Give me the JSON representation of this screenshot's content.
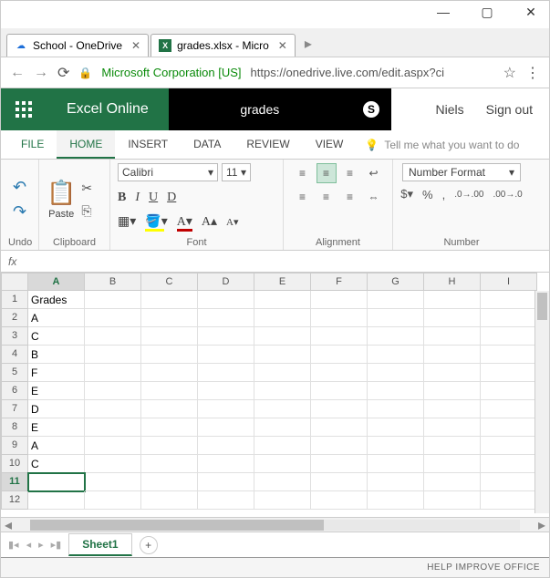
{
  "window": {
    "min": "—",
    "max": "▢",
    "close": "✕"
  },
  "browser": {
    "tabs": [
      {
        "title": "School - OneDrive",
        "icon": "☁"
      },
      {
        "title": "grades.xlsx - Micro",
        "icon": "X"
      }
    ],
    "corp": "Microsoft Corporation [US]",
    "url": "https://onedrive.live.com/edit.aspx?ci"
  },
  "app": {
    "brand": "Excel Online",
    "doc": "grades",
    "user": "Niels",
    "signout": "Sign out"
  },
  "ribbon": {
    "tabs": {
      "file": "FILE",
      "home": "HOME",
      "insert": "INSERT",
      "data": "DATA",
      "review": "REVIEW",
      "view": "VIEW"
    },
    "tellme": "Tell me what you want to do",
    "groups": {
      "undo": "Undo",
      "clipboard": "Clipboard",
      "font": "Font",
      "alignment": "Alignment",
      "number": "Number"
    },
    "paste": "Paste",
    "font_name": "Calibri",
    "font_size": "11",
    "number_format": "Number Format"
  },
  "fx": "fx",
  "sheet": {
    "cols": [
      "A",
      "B",
      "C",
      "D",
      "E",
      "F",
      "G",
      "H",
      "I"
    ],
    "rows": [
      1,
      2,
      3,
      4,
      5,
      6,
      7,
      8,
      9,
      10,
      11,
      12
    ],
    "data": {
      "r1": "Grades",
      "r2": "A",
      "r3": "C",
      "r4": "B",
      "r5": "F",
      "r6": "E",
      "r7": "D",
      "r8": "E",
      "r9": "A",
      "r10": "C"
    },
    "active": {
      "row": 11,
      "col": "A"
    },
    "name": "Sheet1"
  },
  "status": "HELP IMPROVE OFFICE"
}
